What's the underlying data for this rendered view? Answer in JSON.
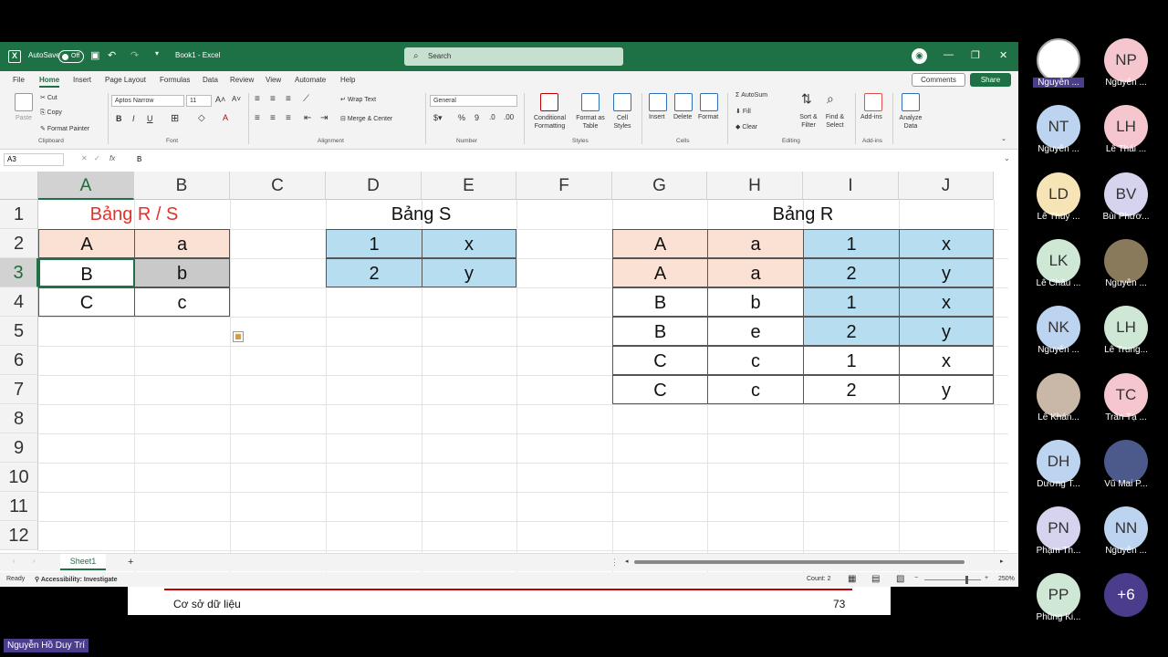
{
  "titlebar": {
    "autosave": "AutoSave",
    "toggle": "Off",
    "doc_title": "Book1 - Excel",
    "search_placeholder": "Search"
  },
  "menu": [
    "File",
    "Home",
    "Insert",
    "Page Layout",
    "Formulas",
    "Data",
    "Review",
    "View",
    "Automate",
    "Help"
  ],
  "menu_active": "Home",
  "actions": {
    "comments": "Comments",
    "share": "Share"
  },
  "ribbon": {
    "clipboard": {
      "paste": "Paste",
      "cut": "Cut",
      "copy": "Copy",
      "format_painter": "Format Painter",
      "group": "Clipboard"
    },
    "font": {
      "name": "Aptos Narrow",
      "size": "11",
      "group": "Font"
    },
    "alignment": {
      "wrap": "Wrap Text",
      "merge": "Merge & Center",
      "group": "Alignment"
    },
    "number": {
      "format": "General",
      "group": "Number"
    },
    "styles": {
      "conditional": "Conditional Formatting",
      "format_table": "Format as Table",
      "cell_styles": "Cell Styles",
      "group": "Styles"
    },
    "cells": {
      "insert": "Insert",
      "delete": "Delete",
      "format": "Format",
      "group": "Cells"
    },
    "editing": {
      "autosum": "AutoSum",
      "fill": "Fill",
      "clear": "Clear",
      "sort": "Sort & Filter",
      "find": "Find & Select",
      "group": "Editing"
    },
    "addins": {
      "addins": "Add-ins",
      "group": "Add-ins"
    },
    "analyze": {
      "label": "Analyze Data"
    }
  },
  "formula_bar": {
    "cell_ref": "A3",
    "fx": "fx",
    "value": "B"
  },
  "columns": [
    "A",
    "B",
    "C",
    "D",
    "E",
    "F",
    "G",
    "H",
    "I",
    "J"
  ],
  "rows": [
    "1",
    "2",
    "3",
    "4",
    "5",
    "6",
    "7",
    "8",
    "9",
    "10",
    "11",
    "12"
  ],
  "selected_cell": "A3",
  "table_rs": {
    "title": "Bảng R / S",
    "title_color": "#e0322b",
    "rows": [
      [
        "A",
        "a"
      ],
      [
        "B",
        "b"
      ],
      [
        "C",
        "c"
      ]
    ]
  },
  "table_s": {
    "title": "Bảng S",
    "rows": [
      [
        "1",
        "x"
      ],
      [
        "2",
        "y"
      ]
    ]
  },
  "table_r": {
    "title": "Bảng R",
    "rows": [
      [
        "A",
        "a",
        "1",
        "x"
      ],
      [
        "A",
        "a",
        "2",
        "y"
      ],
      [
        "B",
        "b",
        "1",
        "x"
      ],
      [
        "B",
        "e",
        "2",
        "y"
      ],
      [
        "C",
        "c",
        "1",
        "x"
      ],
      [
        "C",
        "c",
        "2",
        "y"
      ]
    ]
  },
  "sheet": {
    "tab": "Sheet1",
    "add": "+"
  },
  "status": {
    "ready": "Ready",
    "accessibility": "Accessibility: Investigate",
    "count": "Count: 2",
    "zoom": "250%"
  },
  "slide_footer": {
    "text": "Cơ sở dữ liệu",
    "page": "73"
  },
  "participants": [
    {
      "initials": "",
      "name": "Nguyễn ...",
      "color": "#ffffff",
      "photo": true
    },
    {
      "initials": "NP",
      "name": "Nguyễn ...",
      "color": "#f6c6cf"
    },
    {
      "initials": "NT",
      "name": "Nguyễn ...",
      "color": "#bcd4ef"
    },
    {
      "initials": "LH",
      "name": "Lê Thái ...",
      "color": "#f6c6cf"
    },
    {
      "initials": "LD",
      "name": "Lê Thùy ...",
      "color": "#f7e4b6"
    },
    {
      "initials": "BV",
      "name": "Bùi Phươ...",
      "color": "#d6d3ee"
    },
    {
      "initials": "LK",
      "name": "Lê Châu ...",
      "color": "#cfe8d6"
    },
    {
      "initials": "",
      "name": "Nguyễn ...",
      "color": "#8a7a5c",
      "photo": true
    },
    {
      "initials": "NK",
      "name": "Nguyễn ...",
      "color": "#bcd4ef"
    },
    {
      "initials": "LH",
      "name": "Lê Trung...",
      "color": "#cfe8d6"
    },
    {
      "initials": "",
      "name": "Lê Khán...",
      "color": "#c9b8a8",
      "photo": true
    },
    {
      "initials": "TC",
      "name": "Trần Tạ ...",
      "color": "#f6c6cf"
    },
    {
      "initials": "DH",
      "name": "Dương T...",
      "color": "#bcd4ef"
    },
    {
      "initials": "",
      "name": "Vũ Mai P...",
      "color": "#4b5a8a",
      "photo": true
    },
    {
      "initials": "PN",
      "name": "Phạm Th...",
      "color": "#d6d3ee"
    },
    {
      "initials": "NN",
      "name": "Nguyễn ...",
      "color": "#bcd4ef"
    },
    {
      "initials": "PP",
      "name": "Phùng Ki...",
      "color": "#cfe8d6"
    },
    {
      "initials": "+6",
      "name": "",
      "color": "#4b3d8c"
    }
  ],
  "presenter": "Nguyễn Hồ Duy Trí"
}
